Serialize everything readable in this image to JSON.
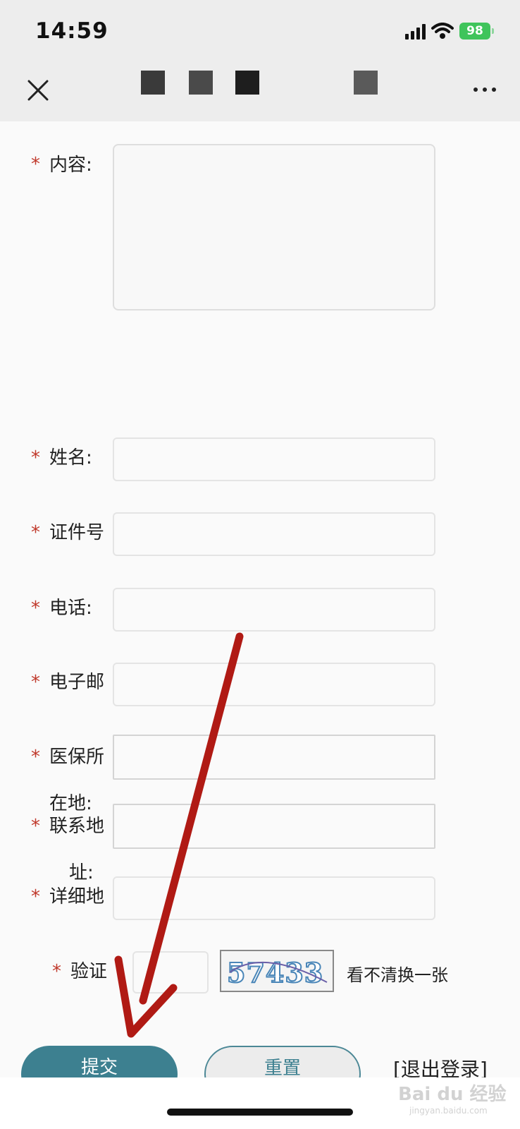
{
  "status_bar": {
    "time": "14:59",
    "battery": "98"
  },
  "form": {
    "content_label": "内容:",
    "required_mark": "*",
    "fields": [
      {
        "label": "姓名:"
      },
      {
        "label": "证件号"
      },
      {
        "label": "电话:"
      },
      {
        "label": "电子邮"
      },
      {
        "label": "医保所",
        "label_cont": "在地:"
      },
      {
        "label": "联系地",
        "label_cont": "址:"
      },
      {
        "label": "详细地"
      }
    ],
    "captcha_label": "验证",
    "captcha_code": "57433",
    "captcha_refresh": "看不清换一张"
  },
  "actions": {
    "submit": "提交",
    "reset": "重置",
    "logout": "[退出登录]"
  },
  "watermark": {
    "brand": "Bai du 经验",
    "url": "jingyan.baidu.com"
  },
  "colors": {
    "accent": "#3d8090",
    "required": "#c0392b",
    "arrow": "#b01a14"
  }
}
